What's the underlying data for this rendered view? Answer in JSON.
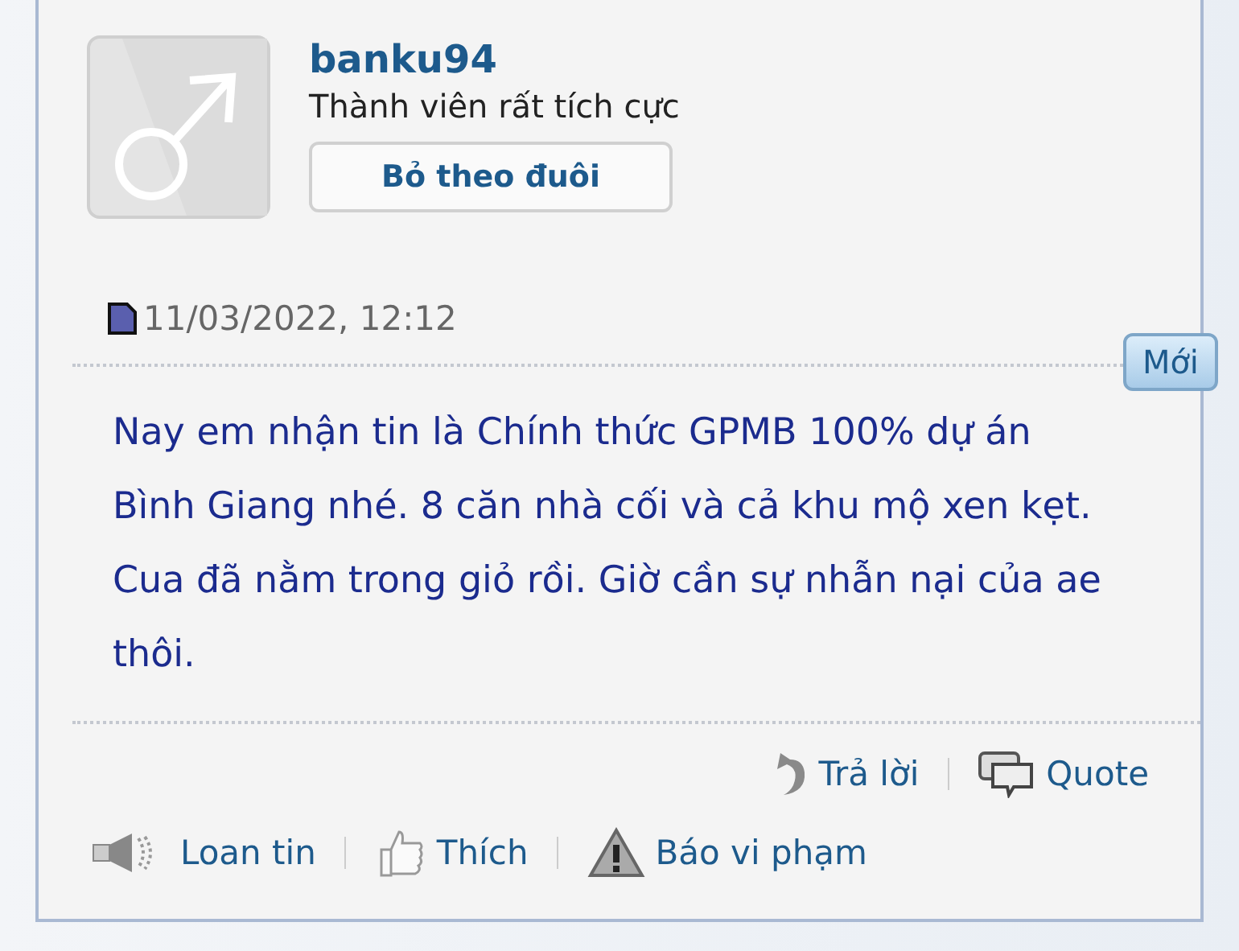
{
  "user": {
    "name": "banku94",
    "title": "Thành viên rất tích cực"
  },
  "follow_button": "Bỏ theo đuôi",
  "post": {
    "date": "11/03/2022, 12:12",
    "badge": "Mới",
    "message": "Nay em nhận tin là Chính thức GPMB 100% dự án Bình Giang nhé. 8 căn nhà cối và cả khu mộ xen kẹt. Cua đã nằm trong giỏ rồi. Giờ cần sự nhẫn nại của ae thôi."
  },
  "reply_actions": [
    {
      "kind": "reply",
      "label": "Trả lời"
    },
    {
      "kind": "quote",
      "label": "Quote"
    }
  ],
  "share_actions": [
    {
      "kind": "share",
      "label": "Loan tin"
    },
    {
      "kind": "like",
      "label": "Thích"
    },
    {
      "kind": "report",
      "label": "Báo vi phạm"
    }
  ]
}
